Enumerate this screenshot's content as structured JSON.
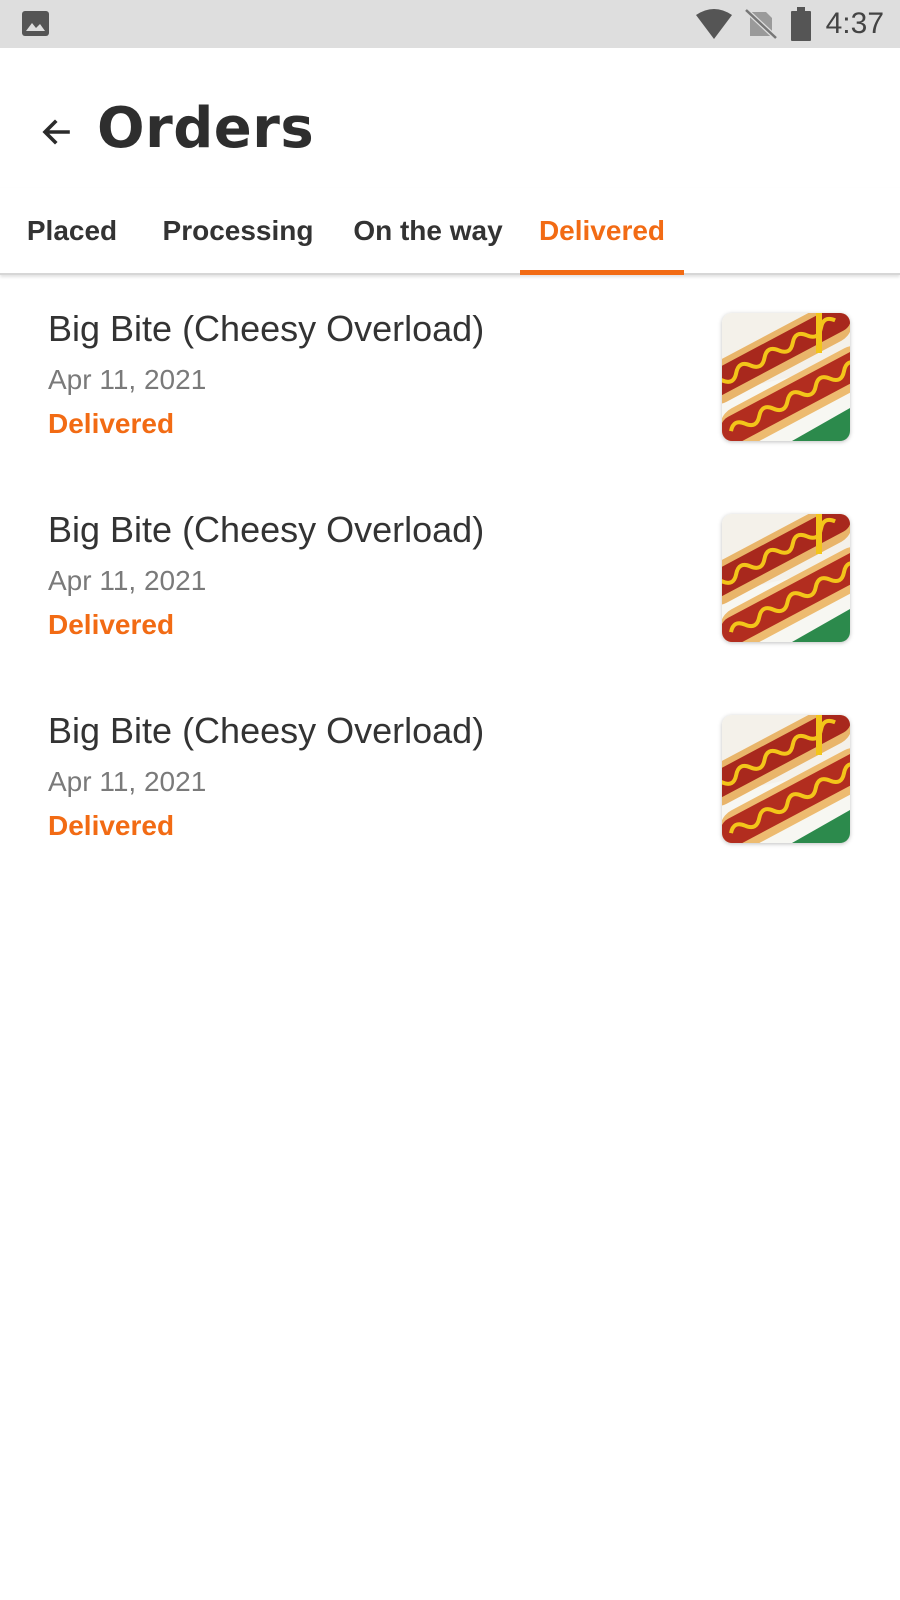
{
  "status_bar": {
    "time": "4:37",
    "icons": [
      "gallery-icon",
      "wifi-icon",
      "no-sim-icon",
      "battery-icon"
    ]
  },
  "header": {
    "title": "Orders",
    "back_icon": "arrow-left-icon"
  },
  "tabs": [
    {
      "label": "Placed",
      "active": false
    },
    {
      "label": "Processing",
      "active": false
    },
    {
      "label": "On the way",
      "active": false
    },
    {
      "label": "Delivered",
      "active": true
    }
  ],
  "orders": [
    {
      "title": "Big Bite (Cheesy Overload)",
      "date": "Apr 11, 2021",
      "status": "Delivered",
      "image": "hotdog-image"
    },
    {
      "title": "Big Bite (Cheesy Overload)",
      "date": "Apr 11, 2021",
      "status": "Delivered",
      "image": "hotdog-image"
    },
    {
      "title": "Big Bite (Cheesy Overload)",
      "date": "Apr 11, 2021",
      "status": "Delivered",
      "image": "hotdog-image"
    }
  ],
  "colors": {
    "accent": "#f26b14",
    "status_bar_bg": "#dedede",
    "text_primary": "#333333",
    "text_secondary": "#7a7a7a"
  }
}
